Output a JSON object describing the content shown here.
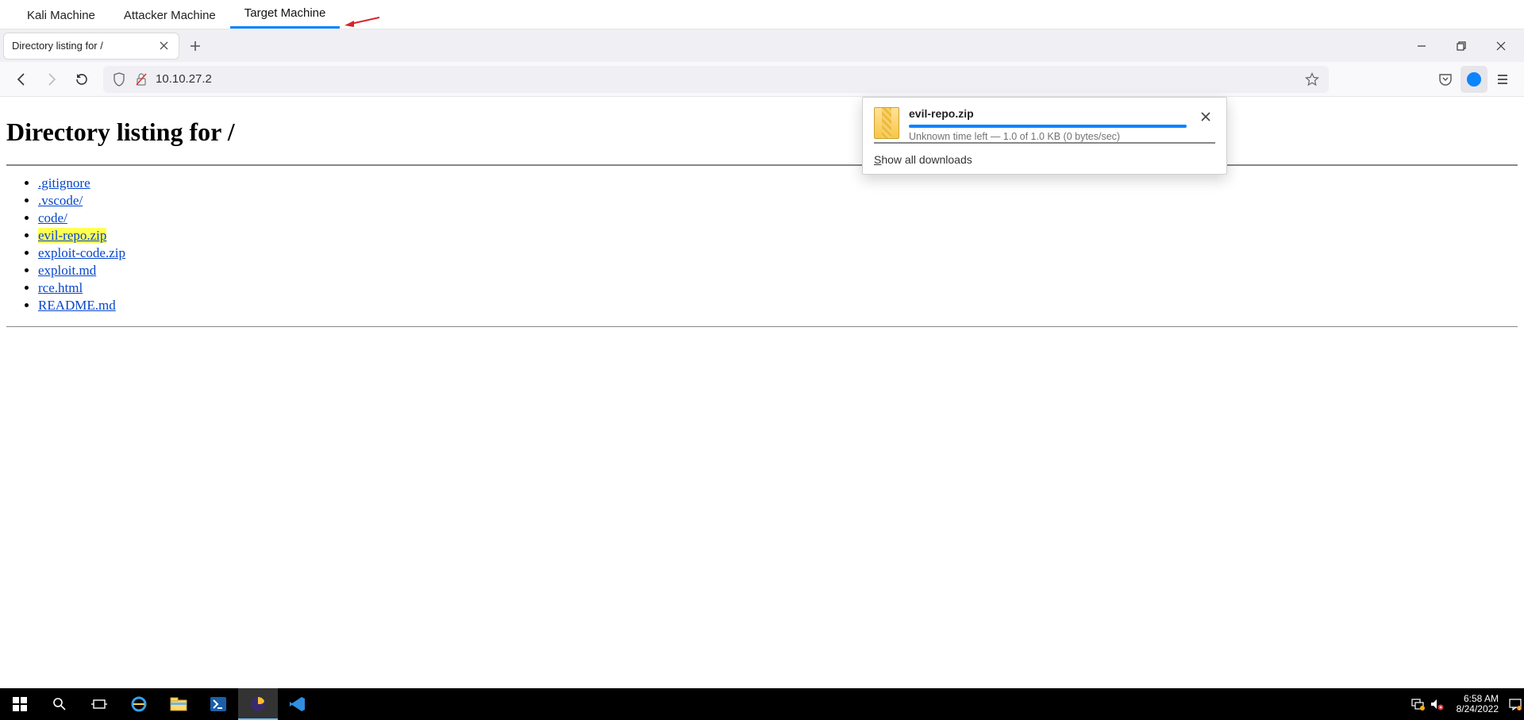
{
  "machine_tabs": {
    "items": [
      "Kali Machine",
      "Attacker Machine",
      "Target Machine"
    ],
    "active_index": 2
  },
  "browser": {
    "tab_title": "Directory listing for /",
    "address": "10.10.27.2"
  },
  "page": {
    "heading": "Directory listing for /",
    "files": [
      {
        "name": ".gitignore",
        "highlight": false
      },
      {
        "name": ".vscode/",
        "highlight": false
      },
      {
        "name": "code/",
        "highlight": false
      },
      {
        "name": "evil-repo.zip",
        "highlight": true
      },
      {
        "name": "exploit-code.zip",
        "highlight": false
      },
      {
        "name": "exploit.md",
        "highlight": false
      },
      {
        "name": "rce.html",
        "highlight": false
      },
      {
        "name": "README.md",
        "highlight": false
      }
    ]
  },
  "download": {
    "filename": "evil-repo.zip",
    "status": "Unknown time left — 1.0 of 1.0 KB (0 bytes/sec)",
    "show_all_prefix": "S",
    "show_all_rest": "how all downloads"
  },
  "taskbar": {
    "time": "6:58 AM",
    "date": "8/24/2022"
  }
}
